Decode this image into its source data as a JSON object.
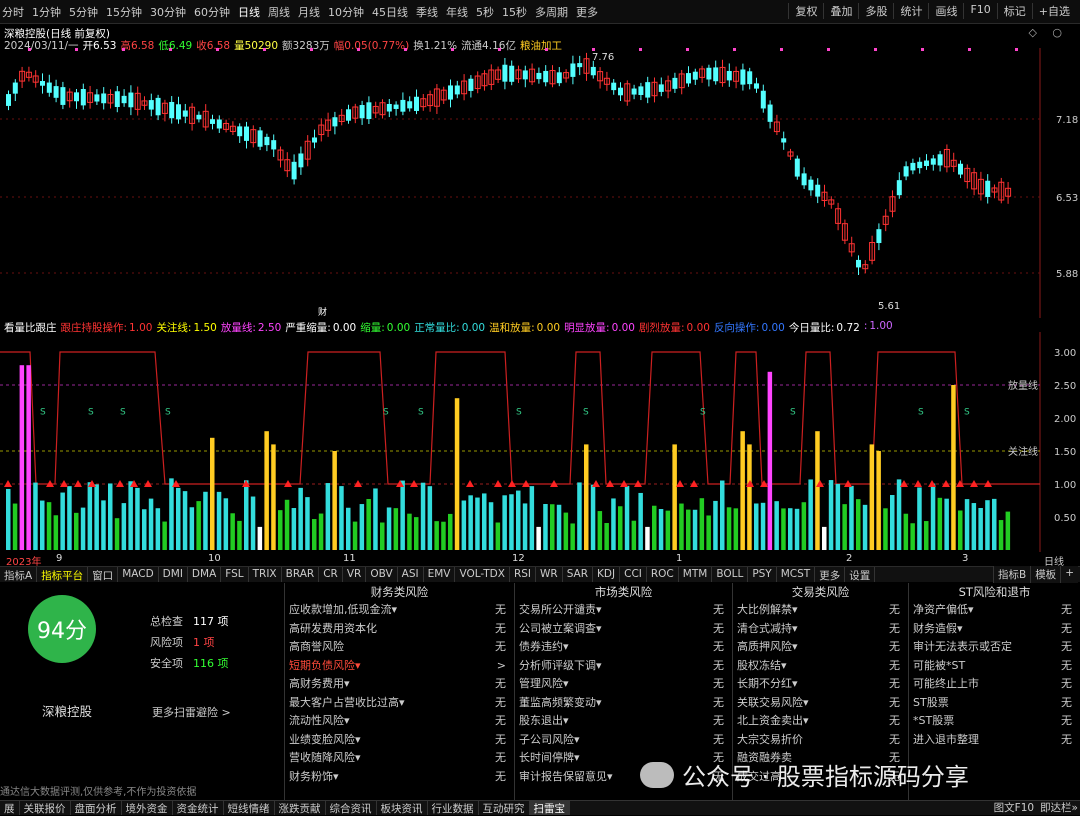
{
  "toolbar": {
    "periods": [
      "分时",
      "1分钟",
      "5分钟",
      "15分钟",
      "30分钟",
      "60分钟",
      "日线",
      "周线",
      "月线",
      "10分钟",
      "45日线",
      "季线",
      "年线",
      "5秒",
      "15秒",
      "多周期",
      "更多"
    ],
    "active_period": "日线",
    "right": [
      "复权",
      "叠加",
      "多股",
      "统计",
      "画线",
      "F10",
      "标记",
      "+自选"
    ]
  },
  "info": {
    "title": "深粮控股(日线 前复权)",
    "date": "2024/03/11/一",
    "open": "开6.53",
    "high": "高6.58",
    "low": "低6.49",
    "close": "收6.58",
    "vol": "量50290",
    "amount": "额3283万",
    "change": "幅0.05(0.77%)",
    "turnover": "换1.21%",
    "float": "流通4.16亿",
    "sector": "粮油加工"
  },
  "winctl": "◇ ○",
  "price_axis": {
    "labels": [
      "7.18",
      "6.53",
      "5.88"
    ],
    "high_mark": "7.76",
    "low_mark": "5.61"
  },
  "caiwu_mark": "财",
  "indicator": {
    "name": "看量比跟庄",
    "items": [
      {
        "label": "跟庄持股操作:",
        "value": "1.00",
        "color": "#ff3333"
      },
      {
        "label": "关注线:",
        "value": "1.50",
        "color": "#ffff00"
      },
      {
        "label": "放量线:",
        "value": "2.50",
        "color": "#ff44ff"
      },
      {
        "label": "严重缩量:",
        "value": "0.00",
        "color": "#ffffff"
      },
      {
        "label": "缩量:",
        "value": "0.00",
        "color": "#33ff33"
      },
      {
        "label": "正常量比:",
        "value": "0.00",
        "color": "#33dddd"
      },
      {
        "label": "温和放量:",
        "value": "0.00",
        "color": "#ffcc22"
      },
      {
        "label": "明显放量:",
        "value": "0.00",
        "color": "#ff44ff"
      },
      {
        "label": "剧烈放量:",
        "value": "0.00",
        "color": "#ff3333"
      },
      {
        "label": "反向操作:",
        "value": "0.00",
        "color": "#3377ff"
      },
      {
        "label": "今日量比:",
        "value": "0.72",
        "color": "#ffffff"
      },
      {
        "label": ":",
        "value": "1.00",
        "color": "#cc66ff"
      }
    ],
    "axis": [
      "3.00",
      "2.50",
      "2.00",
      "1.50",
      "1.00",
      "0.50"
    ],
    "line_labels": {
      "fangliang": "放量线",
      "guanzhu": "关注线"
    }
  },
  "x_axis": {
    "labels": [
      "2023年",
      "9",
      "10",
      "11",
      "12",
      "1",
      "2",
      "3"
    ],
    "right": "日线"
  },
  "tabs": [
    "指标A",
    "指标平台",
    "窗口",
    "MACD",
    "DMI",
    "DMA",
    "FSL",
    "TRIX",
    "BRAR",
    "CR",
    "VR",
    "OBV",
    "ASI",
    "EMV",
    "VOL-TDX",
    "RSI",
    "WR",
    "SAR",
    "KDJ",
    "CCI",
    "ROC",
    "MTM",
    "BOLL",
    "PSY",
    "MCST",
    "更多",
    "设置"
  ],
  "tabs_right": [
    "指标B",
    "模板",
    "+"
  ],
  "risk": {
    "score": "94分",
    "total_label": "总检查",
    "total_value": "117 项",
    "risk_label": "风险项",
    "risk_value": "1 项",
    "safe_label": "安全项",
    "safe_value": "116 项",
    "stock_name": "深粮控股",
    "more": "更多扫雷避险 >",
    "disclaimer": "通达信大数据评测,仅供参考,不作为投资依据",
    "columns": [
      {
        "title": "财务类风险",
        "rows": [
          {
            "label": "应收款增加,低现金流▾",
            "value": "无"
          },
          {
            "label": "高研发费用资本化",
            "value": "无"
          },
          {
            "label": "高商誉风险",
            "value": "无"
          },
          {
            "label": "短期负债风险▾",
            "value": ">",
            "alert": true
          },
          {
            "label": "高财务费用▾",
            "value": "无"
          },
          {
            "label": "最大客户占营收比过高▾",
            "value": "无"
          },
          {
            "label": "流动性风险▾",
            "value": "无"
          },
          {
            "label": "业绩变脸风险▾",
            "value": "无"
          },
          {
            "label": "营收随降风险▾",
            "value": "无"
          },
          {
            "label": "财务粉饰▾",
            "value": "无"
          }
        ]
      },
      {
        "title": "市场类风险",
        "rows": [
          {
            "label": "交易所公开谴责▾",
            "value": "无"
          },
          {
            "label": "公司被立案调查▾",
            "value": "无"
          },
          {
            "label": "债券违约▾",
            "value": "无"
          },
          {
            "label": "分析师评级下调▾",
            "value": "无"
          },
          {
            "label": "管理风险▾",
            "value": "无"
          },
          {
            "label": "董监高频繁变动▾",
            "value": "无"
          },
          {
            "label": "股东退出▾",
            "value": "无"
          },
          {
            "label": "子公司风险▾",
            "value": "无"
          },
          {
            "label": "长时间停牌▾",
            "value": "无"
          },
          {
            "label": "审计报告保留意见▾",
            "value": "无"
          }
        ]
      },
      {
        "title": "交易类风险",
        "rows": [
          {
            "label": "大比例解禁▾",
            "value": "无"
          },
          {
            "label": "清仓式减持▾",
            "value": "无"
          },
          {
            "label": "高质押风险▾",
            "value": "无"
          },
          {
            "label": "股权冻结▾",
            "value": "无"
          },
          {
            "label": "长期不分红▾",
            "value": "无"
          },
          {
            "label": "关联交易风险▾",
            "value": "无"
          },
          {
            "label": "北上资金卖出▾",
            "value": "无"
          },
          {
            "label": "大宗交易折价",
            "value": "无"
          },
          {
            "label": "融资融券卖",
            "value": "无"
          },
          {
            "label": "成交过高",
            "value": "无"
          }
        ]
      },
      {
        "title": "ST风险和退市",
        "rows": [
          {
            "label": "净资产偏低▾",
            "value": "无"
          },
          {
            "label": "财务造假▾",
            "value": "无"
          },
          {
            "label": "审计无法表示或否定",
            "value": "无"
          },
          {
            "label": "可能被*ST",
            "value": "无"
          },
          {
            "label": "可能终止上市",
            "value": "无"
          },
          {
            "label": "ST股票",
            "value": "无"
          },
          {
            "label": "*ST股票",
            "value": "无"
          },
          {
            "label": "进入退市整理",
            "value": "无"
          }
        ]
      }
    ]
  },
  "bottom": {
    "tabs": [
      "展",
      "关联报价",
      "盘面分析",
      "境外资金",
      "资金统计",
      "短线情绪",
      "涨跌贡献",
      "综合资讯",
      "板块资讯",
      "行业数据",
      "互动研究",
      "扫雷宝"
    ],
    "active": "扫雷宝",
    "right": [
      "图文F10",
      "即达栏»"
    ]
  },
  "watermark": "公众号 · 股票指标源码分享",
  "colors": {
    "up": "#ff3333",
    "down": "#54ffff",
    "vr_cyan": "#33dddd",
    "vr_green": "#22cc22",
    "vr_yellow": "#ffcc22",
    "vr_magenta": "#ff44ff"
  }
}
